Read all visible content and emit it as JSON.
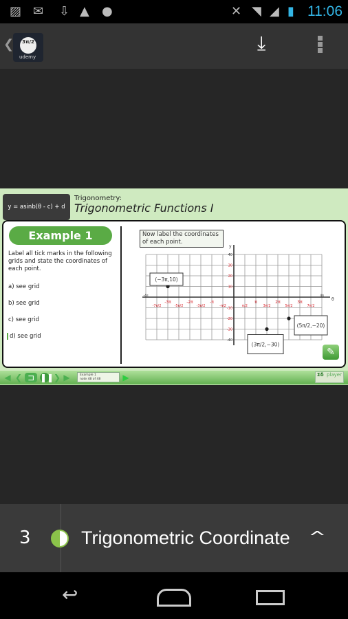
{
  "status_bar": {
    "time": "11:06",
    "icons": [
      "gallery-icon",
      "gmail-icon",
      "download-notification-icon",
      "warning-icon",
      "android-icon",
      "mute-icon",
      "wifi-icon",
      "signal-icon",
      "battery-icon"
    ]
  },
  "app_bar": {
    "logo_text": "3π/2",
    "logo_brand": "udemy",
    "actions": [
      "download-icon",
      "overflow-menu-icon"
    ]
  },
  "video": {
    "formula": "y = asinb(θ - c) + d",
    "subject": "Trigonometry:",
    "title": "Trigonometric Functions I",
    "example_label": "Example 1",
    "instructions": "Label all tick marks in the following grids and state the coordinates of each point.",
    "answers": [
      "a) see grid",
      "b) see grid",
      "c) see grid",
      "d) see grid"
    ],
    "note": "Now label the coordinates of each point.",
    "graph": {
      "y_axis_label": "y",
      "x_axis_label": "θ",
      "y_ticks": [
        "40",
        "30",
        "20",
        "10",
        "-10",
        "-20",
        "-30",
        "-40"
      ],
      "x_ticks_pos": [
        "π/2",
        "π",
        "3π/2",
        "2π",
        "5π/2",
        "3π",
        "7π/2",
        "4π"
      ],
      "x_ticks_neg": [
        "-4π",
        "-7π/2",
        "-3π",
        "-5π/2",
        "-2π",
        "-3π/2",
        "-π",
        "-π/2"
      ],
      "points": [
        {
          "label": "(−3π,10)",
          "x_pi": -3,
          "y": 10
        },
        {
          "label": "(3π/2,−30)",
          "x_pi": 1.5,
          "y": -30
        },
        {
          "label": "(5π/2,−20)",
          "x_pi": 2.5,
          "y": -20
        }
      ],
      "tick_color": "#d8232a"
    },
    "controls": {
      "slide_title": "Example 1",
      "slide_position": "note 48 of 48",
      "brand": "player"
    }
  },
  "bottom_panel": {
    "number": "3",
    "title": "Trigonometric Coordinate",
    "progress": 0.5
  },
  "colors": {
    "accent": "#5aab45",
    "clock": "#33b5e5"
  }
}
